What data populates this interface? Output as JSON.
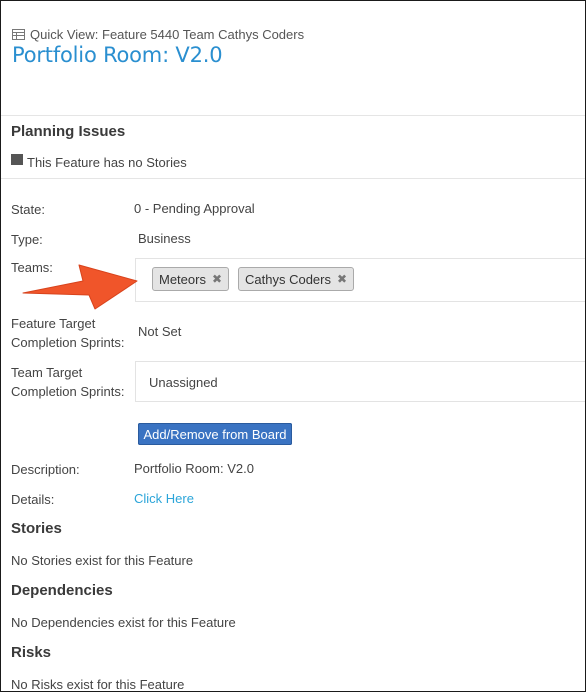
{
  "header": {
    "quick_view": "Quick View: Feature 5440 Team Cathys Coders",
    "title": "Portfolio Room: V2.0",
    "quick_view_icon": "table-icon"
  },
  "planning": {
    "heading": "Planning Issues",
    "message": "This Feature has no Stories"
  },
  "fields": {
    "state_label": "State:",
    "state_value": "0 - Pending Approval",
    "type_label": "Type:",
    "type_value": "Business",
    "teams_label": "Teams:",
    "teams": [
      {
        "name": "Meteors"
      },
      {
        "name": "Cathys Coders"
      }
    ],
    "feature_target_label_1": "Feature Target",
    "feature_target_label_2": "Completion Sprints:",
    "feature_target_value": "Not Set",
    "team_target_label_1": "Team Target",
    "team_target_label_2": "Completion Sprints:",
    "team_target_value": "Unassigned",
    "board_button": "Add/Remove from Board",
    "description_label": "Description:",
    "description_value": "Portfolio Room: V2.0",
    "details_label": "Details:",
    "details_link": "Click Here"
  },
  "stories": {
    "heading": "Stories",
    "message": "No Stories exist for this Feature"
  },
  "dependencies": {
    "heading": "Dependencies",
    "message": "No Dependencies exist for this Feature"
  },
  "risks": {
    "heading": "Risks",
    "message": "No Risks exist for this Feature"
  },
  "colors": {
    "title": "#2a8fd0",
    "link": "#2ba5d9",
    "button": "#3a73c2",
    "arrow": "#f0552a"
  },
  "chip_remove_glyph": "✖"
}
